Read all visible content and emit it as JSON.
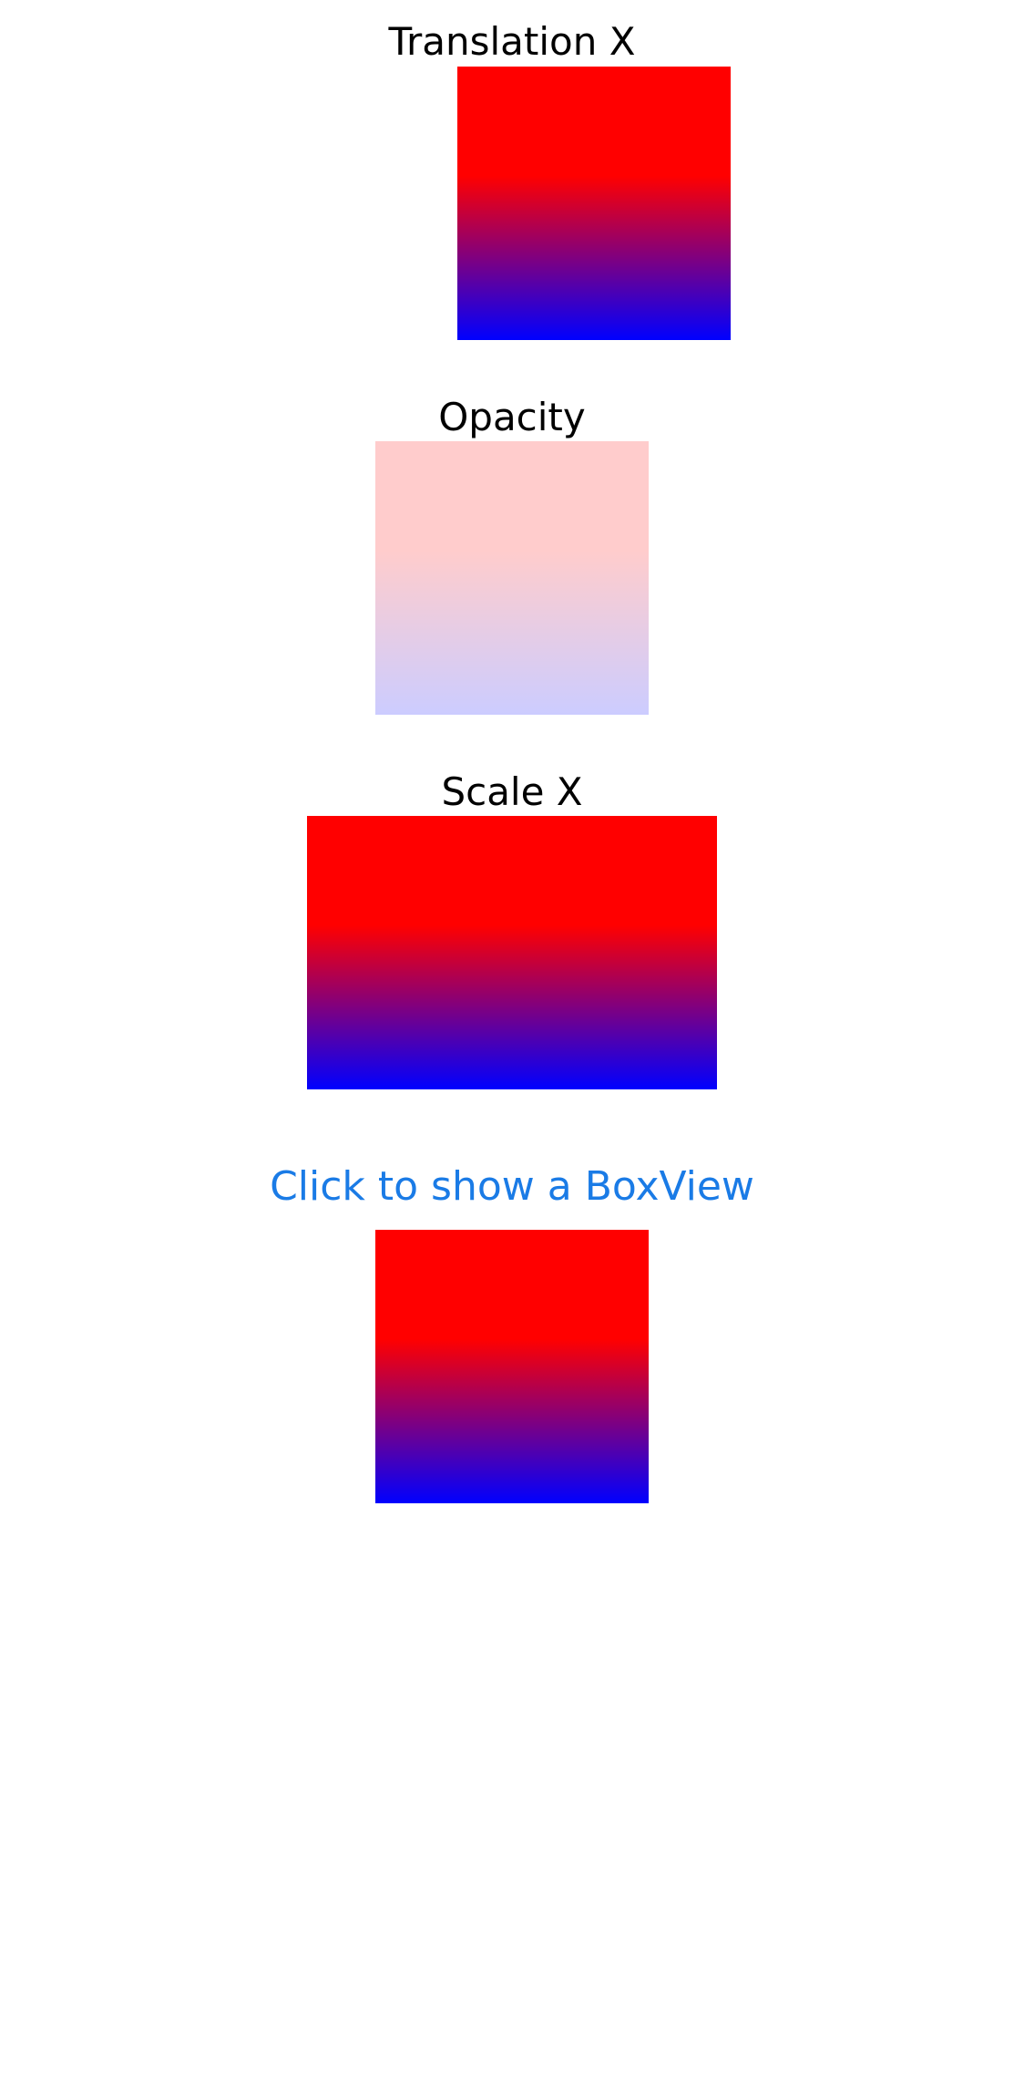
{
  "sections": {
    "translation": {
      "title": "Translation X"
    },
    "opacity": {
      "title": "Opacity",
      "opacity_value": 0.2
    },
    "scale": {
      "title": "Scale X"
    }
  },
  "action_button": {
    "label": "Click to show a BoxView"
  },
  "colors": {
    "gradient_start": "#ff0000",
    "gradient_end": "#0000ff",
    "link": "#1a7be6",
    "text": "#000000",
    "background": "#ffffff"
  }
}
